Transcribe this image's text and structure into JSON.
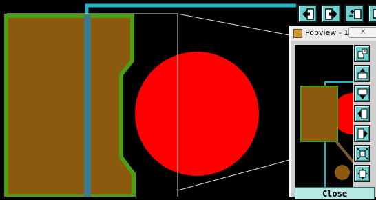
{
  "colors": {
    "background": "#000000",
    "copper": "#8b5a0f",
    "copper_outline": "#4aa012",
    "pad": "#ff0000",
    "trace": "#1fb6c8",
    "dim_trace": "#3e7a8a",
    "guide_line": "#dddddd",
    "button_face": "#6fd0d0"
  },
  "toolbar": {
    "buttons": [
      {
        "name": "move-left-button",
        "icon": "arrow-left-into-box-icon"
      },
      {
        "name": "move-right-button",
        "icon": "arrow-right-out-box-icon"
      },
      {
        "name": "swap-button",
        "icon": "swap-boxes-icon"
      },
      {
        "name": "stack-button",
        "icon": "stacked-boxes-icon"
      }
    ]
  },
  "popview": {
    "title": "Popview - 1",
    "close_x": "X",
    "close_label": "Close",
    "side_buttons": [
      {
        "name": "zoom-box-button",
        "icon": "zoom-box-icon"
      },
      {
        "name": "zoom-up-button",
        "icon": "arrow-up-box-icon"
      },
      {
        "name": "zoom-down-button",
        "icon": "arrow-down-box-icon"
      },
      {
        "name": "pan-left-button",
        "icon": "arrow-left-box-icon"
      },
      {
        "name": "pan-right-button",
        "icon": "arrow-right-box-icon"
      },
      {
        "name": "zoom-in-button",
        "icon": "expand-arrows-icon"
      },
      {
        "name": "zoom-out-button",
        "icon": "collapse-arrows-icon"
      }
    ]
  }
}
